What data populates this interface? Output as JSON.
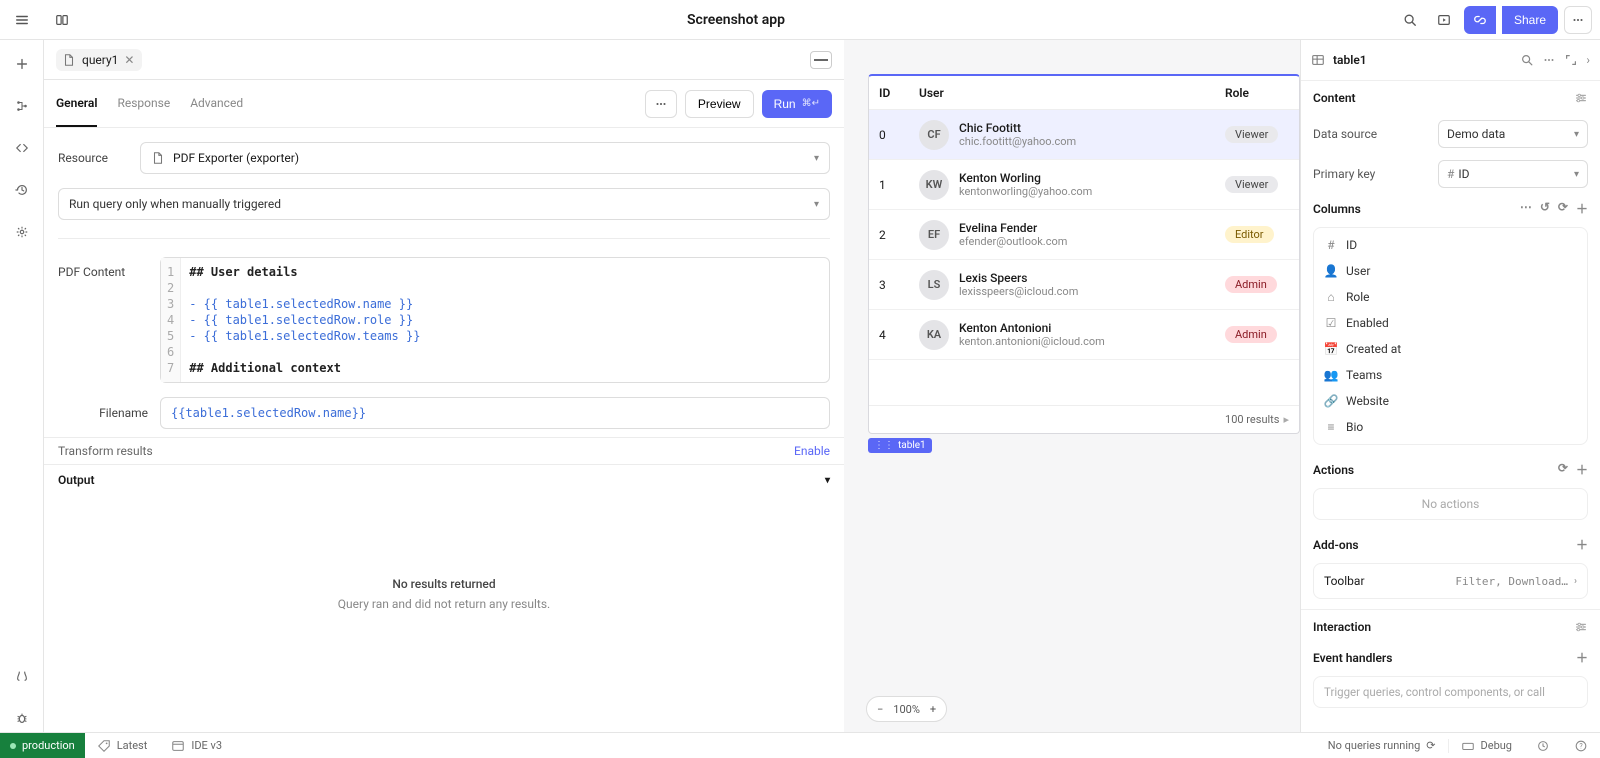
{
  "topbar": {
    "app_title": "Screenshot app",
    "share_label": "Share"
  },
  "query_panel": {
    "tab_label": "query1",
    "subtabs": {
      "general": "General",
      "response": "Response",
      "advanced": "Advanced"
    },
    "preview_label": "Preview",
    "run_label": "Run",
    "run_shortcut": "⌘↵",
    "resource_label": "Resource",
    "resource_value": "PDF Exporter (exporter)",
    "trigger_value": "Run query only when manually triggered",
    "pdf_content_label": "PDF Content",
    "code_gutter": [
      "1",
      "2",
      "3",
      "4",
      "5",
      "6",
      "7"
    ],
    "code_lines": [
      {
        "text": "## User details",
        "cls": "tok-bold"
      },
      {
        "text": "",
        "cls": ""
      },
      {
        "text": "- {{ table1.selectedRow.name }}",
        "cls": "tok-expr"
      },
      {
        "text": "- {{ table1.selectedRow.role }}",
        "cls": "tok-expr"
      },
      {
        "text": "- {{ table1.selectedRow.teams }}",
        "cls": "tok-expr"
      },
      {
        "text": "",
        "cls": ""
      },
      {
        "text": "## Additional context",
        "cls": "tok-bold"
      }
    ],
    "filename_label": "Filename",
    "filename_value": "{{table1.selectedRow.name}}",
    "transform_label": "Transform results",
    "transform_enable": "Enable",
    "output_label": "Output",
    "output_title": "No results returned",
    "output_sub": "Query ran and did not return any results."
  },
  "canvas": {
    "selection_chip": "table1",
    "zoom": "100%",
    "table": {
      "headers": {
        "id": "ID",
        "user": "User",
        "role": "Role"
      },
      "rows": [
        {
          "id": "0",
          "initials": "CF",
          "name": "Chic Footitt",
          "email": "chic.footitt@yahoo.com",
          "role": "Viewer",
          "role_class": "viewer",
          "selected": true
        },
        {
          "id": "1",
          "initials": "KW",
          "name": "Kenton Worling",
          "email": "kentonworling@yahoo.com",
          "role": "Viewer",
          "role_class": "viewer",
          "selected": false
        },
        {
          "id": "2",
          "initials": "EF",
          "name": "Evelina Fender",
          "email": "efender@outlook.com",
          "role": "Editor",
          "role_class": "editor",
          "selected": false
        },
        {
          "id": "3",
          "initials": "LS",
          "name": "Lexis Speers",
          "email": "lexisspeers@icloud.com",
          "role": "Admin",
          "role_class": "admin",
          "selected": false
        },
        {
          "id": "4",
          "initials": "KA",
          "name": "Kenton Antonioni",
          "email": "kenton.antonioni@icloud.com",
          "role": "Admin",
          "role_class": "admin",
          "selected": false
        }
      ],
      "footer": "100 results"
    }
  },
  "inspector": {
    "title": "table1",
    "content_label": "Content",
    "data_source_label": "Data source",
    "data_source_value": "Demo data",
    "primary_key_label": "Primary key",
    "primary_key_value": "ID",
    "columns_label": "Columns",
    "columns": [
      {
        "icon": "#",
        "label": "ID"
      },
      {
        "icon": "person",
        "label": "User"
      },
      {
        "icon": "tag",
        "label": "Role"
      },
      {
        "icon": "check",
        "label": "Enabled"
      },
      {
        "icon": "calendar",
        "label": "Created at"
      },
      {
        "icon": "people",
        "label": "Teams"
      },
      {
        "icon": "link",
        "label": "Website"
      },
      {
        "icon": "text",
        "label": "Bio"
      }
    ],
    "actions_label": "Actions",
    "no_actions": "No actions",
    "addons_label": "Add-ons",
    "addon_toolbar_label": "Toolbar",
    "addon_toolbar_meta": "Filter, Download…",
    "interaction_label": "Interaction",
    "event_handlers_label": "Event handlers",
    "event_placeholder": "Trigger queries, control components, or call"
  },
  "statusbar": {
    "env": "production",
    "latest": "Latest",
    "ide": "IDE v3",
    "queries": "No queries running",
    "debug": "Debug"
  }
}
